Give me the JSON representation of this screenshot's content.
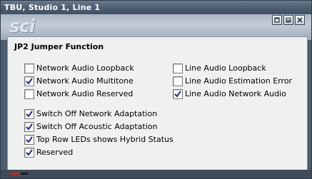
{
  "window": {
    "title": "TBU, Studio 1, Line 1",
    "logo": "sci"
  },
  "icons": {
    "restore": "restore-icon",
    "minimize": "minimize-icon",
    "close": "close-icon",
    "check": "checkmark-icon"
  },
  "colors": {
    "title_bar": "#4d5d70",
    "panel": "#f0f0f0",
    "check": "#1c2a86",
    "led_red": "#d02020"
  },
  "panel": {
    "title": "JP2 Jumper Function",
    "left_column": [
      {
        "label": "Network Audio Loopback",
        "checked": false
      },
      {
        "label": "Network Audio Multitone",
        "checked": true
      },
      {
        "label": "Network Audio Reserved",
        "checked": false
      }
    ],
    "right_column": [
      {
        "label": "Line Audio Loopback",
        "checked": false
      },
      {
        "label": "Line Audio Estimation Error",
        "checked": false
      },
      {
        "label": "Line Audio Network Audio",
        "checked": true
      }
    ],
    "bottom_group": [
      {
        "label": "Switch Off Network Adaptation",
        "checked": true
      },
      {
        "label": "Switch Off Acoustic Adaptation",
        "checked": true
      },
      {
        "label": "Top Row LEDs shows Hybrid Status",
        "checked": true
      },
      {
        "label": "Reserved",
        "checked": true
      }
    ]
  }
}
